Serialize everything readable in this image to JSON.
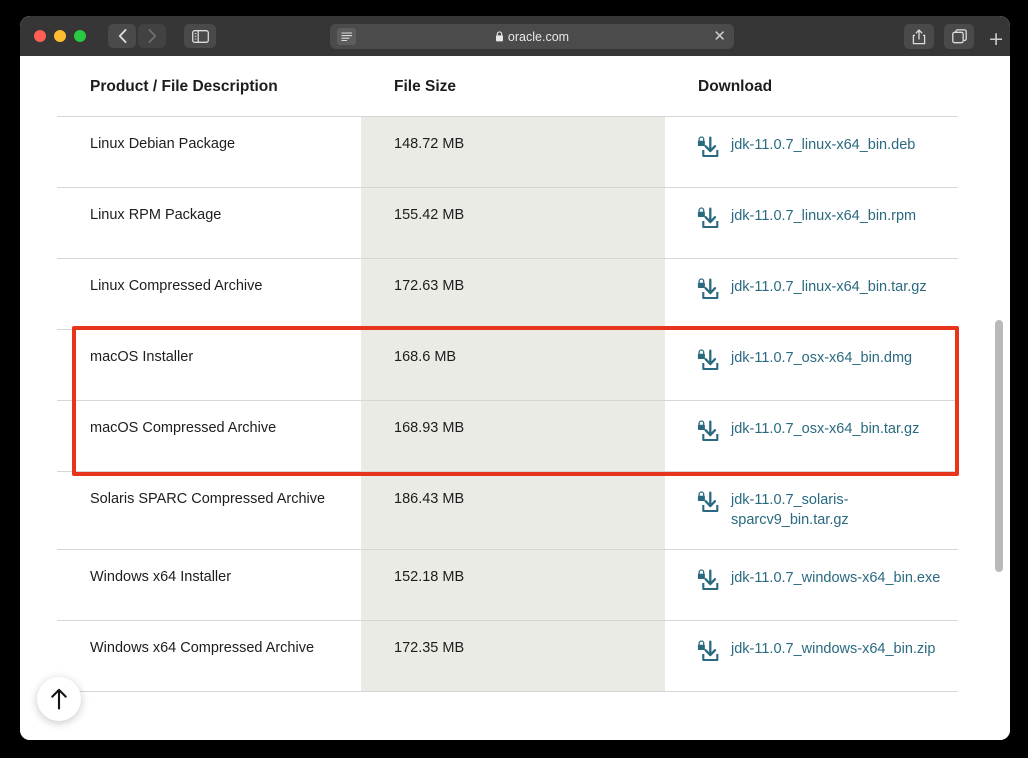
{
  "browser": {
    "traffic_lights": [
      "close",
      "minimize",
      "maximize"
    ],
    "back_label": "‹",
    "forward_label": "›",
    "url": "oracle.com",
    "lock_icon": "lock-icon",
    "reader_icon": "reader-view-icon",
    "close_tab_label": "✕",
    "share_icon": "share-icon",
    "tabs_icon": "tab-overview-icon",
    "newtab_label": "+"
  },
  "table": {
    "headers": {
      "product": "Product / File Description",
      "size": "File Size",
      "download": "Download"
    },
    "rows": [
      {
        "product": "Linux Debian Package",
        "size": "148.72 MB",
        "file": "jdk-11.0.7_linux-x64_bin.deb"
      },
      {
        "product": "Linux RPM Package",
        "size": "155.42 MB",
        "file": "jdk-11.0.7_linux-x64_bin.rpm"
      },
      {
        "product": "Linux Compressed Archive",
        "size": "172.63 MB",
        "file": "jdk-11.0.7_linux-x64_bin.tar.gz"
      },
      {
        "product": "macOS Installer",
        "size": "168.6 MB",
        "file": "jdk-11.0.7_osx-x64_bin.dmg"
      },
      {
        "product": "macOS Compressed Archive",
        "size": "168.93 MB",
        "file": "jdk-11.0.7_osx-x64_bin.tar.gz"
      },
      {
        "product": "Solaris SPARC Compressed Archive",
        "size": "186.43 MB",
        "file": "jdk-11.0.7_solaris-sparcv9_bin.tar.gz"
      },
      {
        "product": "Windows x64 Installer",
        "size": "152.18 MB",
        "file": "jdk-11.0.7_windows-x64_bin.exe"
      },
      {
        "product": "Windows x64 Compressed Archive",
        "size": "172.35 MB",
        "file": "jdk-11.0.7_windows-x64_bin.zip"
      }
    ],
    "highlighted_rows": [
      3,
      4
    ]
  },
  "annotation": {
    "type": "red-highlight-box",
    "color": "#e8341c"
  },
  "back_to_top": {
    "icon": "arrow-up-icon"
  },
  "colors": {
    "link": "#2a6a80",
    "size_column_bg": "#ebebe6",
    "highlight": "#e8341c",
    "chrome": "#363636"
  }
}
